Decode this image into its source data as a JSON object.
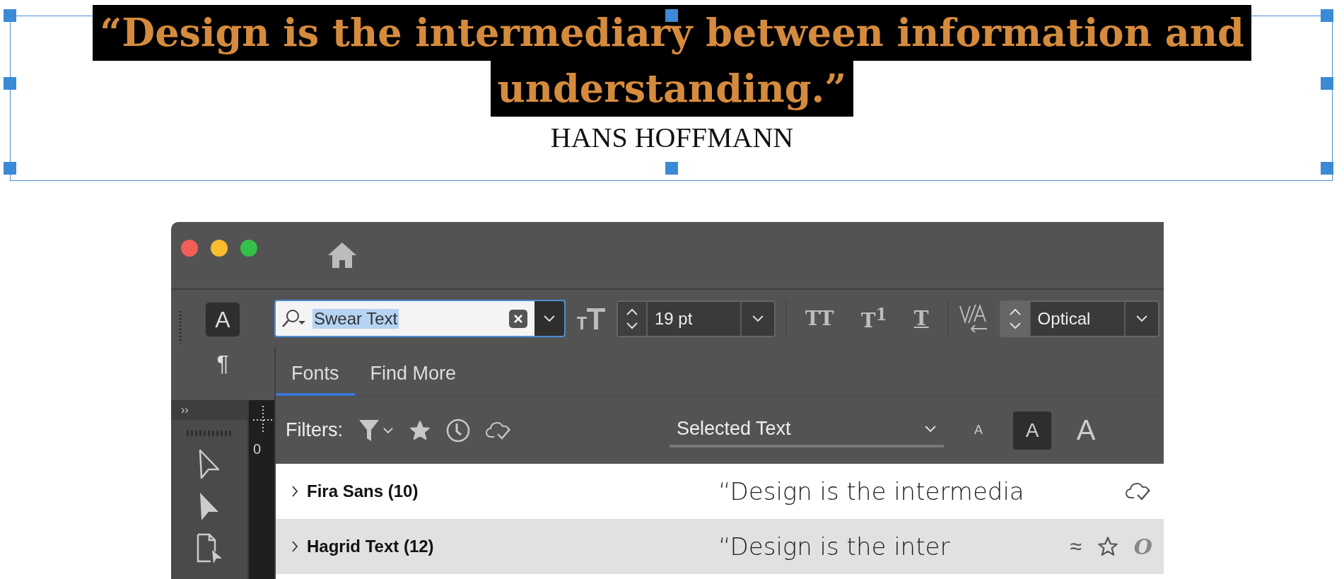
{
  "quote_frame": {
    "quote_lines": [
      "“Design is the intermediary between information and",
      "understanding.”"
    ],
    "attribution": "HANS HOFFMANN"
  },
  "app": {
    "tool_modes": [
      {
        "label": "A",
        "selected": true
      },
      {
        "label": "¶",
        "selected": false
      }
    ],
    "collapse_label": "››",
    "ruler": {
      "label": "0"
    },
    "search_field": {
      "value": "Swear Text"
    },
    "font_size": {
      "value": "19 pt"
    },
    "type_buttons": [
      {
        "kind": "caps",
        "label": "TT"
      },
      {
        "kind": "superscript",
        "label": "T$^{1}$"
      },
      {
        "kind": "underline",
        "label": "T"
      }
    ],
    "kerning": {
      "value": "Optical"
    },
    "tabs": [
      {
        "label": "Fonts",
        "selected": true
      },
      {
        "label": "Find More",
        "selected": false
      }
    ],
    "filters": {
      "label": "Filters:"
    },
    "show_dropdown": {
      "value": "Selected Text"
    },
    "sample_sizes": [
      {
        "label": "A",
        "selected": false
      },
      {
        "label": "A",
        "selected": true
      },
      {
        "label": "A",
        "selected": false
      }
    ],
    "fonts": [
      {
        "name": "Fira Sans (10)",
        "sample": "“Design is the intermedia",
        "selected": false,
        "synced": true
      },
      {
        "name": "Hagrid Text (12)",
        "sample": "“Design is the inter",
        "selected": true,
        "synced": false,
        "similar": "≈",
        "favorite": false,
        "type_mark": "O"
      }
    ]
  }
}
